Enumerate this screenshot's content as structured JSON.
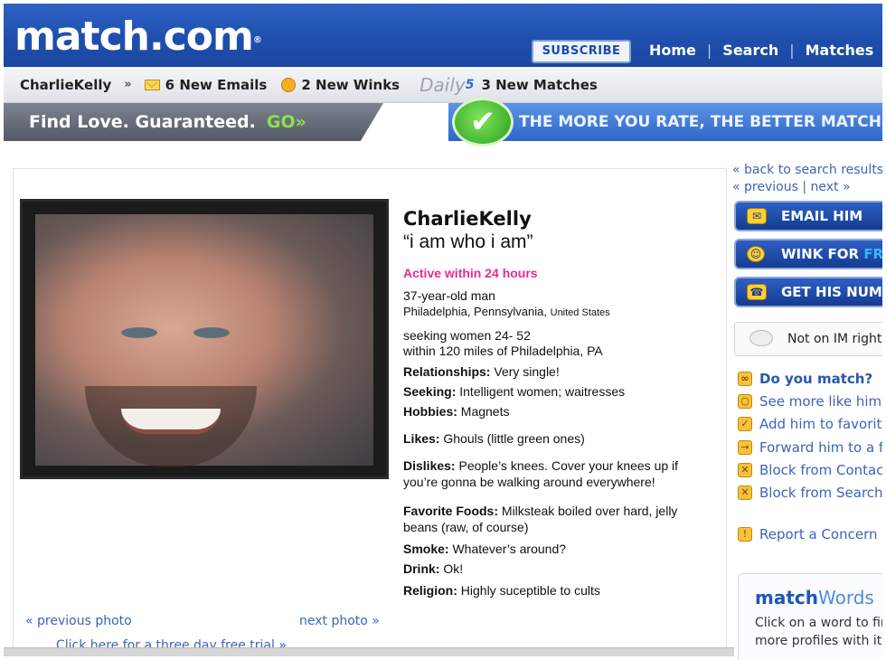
{
  "header": {
    "logo": "match.com",
    "logo_mark": "®",
    "subscribe": "SUBSCRIBE",
    "nav": [
      "Home",
      "Search",
      "Matches"
    ],
    "separator": "|"
  },
  "member_bar": {
    "username": "CharlieKelly",
    "raquo": "»",
    "emails": "6 New Emails",
    "winks": "2 New Winks",
    "daily_label": "Daily",
    "daily_num": "5",
    "matches": "3 New Matches"
  },
  "promo": {
    "left_text": "Find Love. Guaranteed.",
    "go": "GO»",
    "check": "✔",
    "right_text": "THE MORE YOU RATE, THE BETTER MATCHES YOU GET"
  },
  "photo": {
    "previous": "« previous photo",
    "next": "next photo »",
    "trial": "Click here for a three day free trial »"
  },
  "profile": {
    "name": "CharlieKelly",
    "tagline": "“i am who i am”",
    "active": "Active within 24 hours",
    "age": "37-year-old man",
    "location_city": "Philadelphia, Pennsylvania,",
    "location_country": "United States",
    "seeking_range": "seeking women 24- 52",
    "seeking_radius": "within 120 miles of Philadelphia, PA",
    "fields": [
      {
        "label": "Relationships:",
        "value": "Very single!"
      },
      {
        "label": "Seeking:",
        "value": "Intelligent women; waitresses"
      },
      {
        "label": "Hobbies:",
        "value": "Magnets"
      },
      {
        "label": "Likes:",
        "value": "Ghouls (little green ones)"
      },
      {
        "label": "Dislikes:",
        "value": "People’s knees. Cover your knees up if you’re gonna be walking around everywhere!"
      },
      {
        "label": "Favorite Foods:",
        "value": "Milksteak boiled over hard, jelly beans (raw, of course)"
      },
      {
        "label": "Smoke:",
        "value": "Whatever’s around?"
      },
      {
        "label": "Drink:",
        "value": "Ok!"
      },
      {
        "label": "Religion:",
        "value": "Highly suceptible to cults"
      }
    ]
  },
  "sidebar": {
    "back": "« back to search results",
    "previous": "« previous",
    "pipe": "|",
    "next": "next »",
    "email_btn": "EMAIL HIM",
    "wink_btn": "WINK FOR",
    "wink_free": "FREE",
    "number_btn": "GET HIS NUMBER",
    "im_status": "Not on IM right now",
    "options": [
      "Do you match?",
      "See more like him",
      "Add him to favorites",
      "Forward him to a friend",
      "Block from Contact",
      "Block from Search"
    ],
    "report": "Report a Concern",
    "words_title_bold": "match",
    "words_title_rest": "Words",
    "words_desc_1": "Click on a word to find",
    "words_desc_2": "more profiles with it"
  }
}
